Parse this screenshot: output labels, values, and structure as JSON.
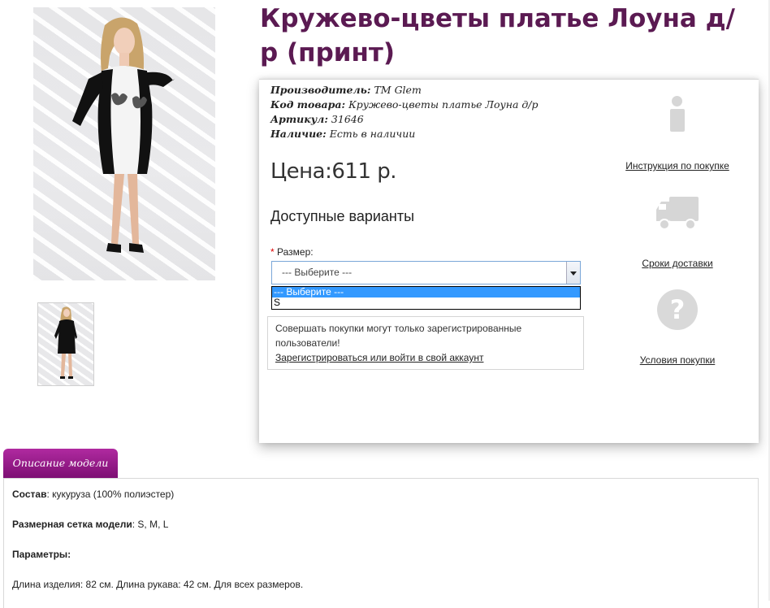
{
  "product": {
    "title": "Кружево-цветы платье Лоуна д/р (принт)",
    "meta": [
      {
        "label": "Производитель:",
        "value": "ТМ Glem"
      },
      {
        "label": "Код товара:",
        "value": "Кружево-цветы платье Лоуна д/р"
      },
      {
        "label": "Артикул:",
        "value": "31646"
      },
      {
        "label": "Наличие:",
        "value": "Есть в наличии"
      }
    ],
    "price": "Цена:611 р."
  },
  "options": {
    "heading": "Доступные варианты",
    "required_mark": "*",
    "size_label": "Размер:",
    "select_value": "--- Выберите ---",
    "dropdown_options": [
      "--- Выберите ---",
      "S"
    ],
    "selected_index": 0
  },
  "notice": {
    "text": "Совершать покупки могут только зарегистрированные пользователи!",
    "link": "Зарегистрироваться или войти в свой аккаунт"
  },
  "side_links": [
    {
      "icon": "info-icon",
      "label": "Инструкция по покупке"
    },
    {
      "icon": "truck-icon",
      "label": "Сроки доставки"
    },
    {
      "icon": "question-icon",
      "label": "Условия покупки"
    }
  ],
  "description": {
    "tab_label": "Описание модели",
    "composition_label": "Состав",
    "composition_value": ": кукуруза (100% полиэстер)",
    "sizes_label": "Размерная сетка модели",
    "sizes_value": ": S, M, L",
    "params_label": "Параметры:",
    "lengths": "Длина изделия: 82 см. Длина рукава: 42 см. Для всех размеров."
  },
  "colors": {
    "title": "#5b1a52",
    "tab": "#9b1d8e",
    "select_highlight": "#3399ff"
  }
}
